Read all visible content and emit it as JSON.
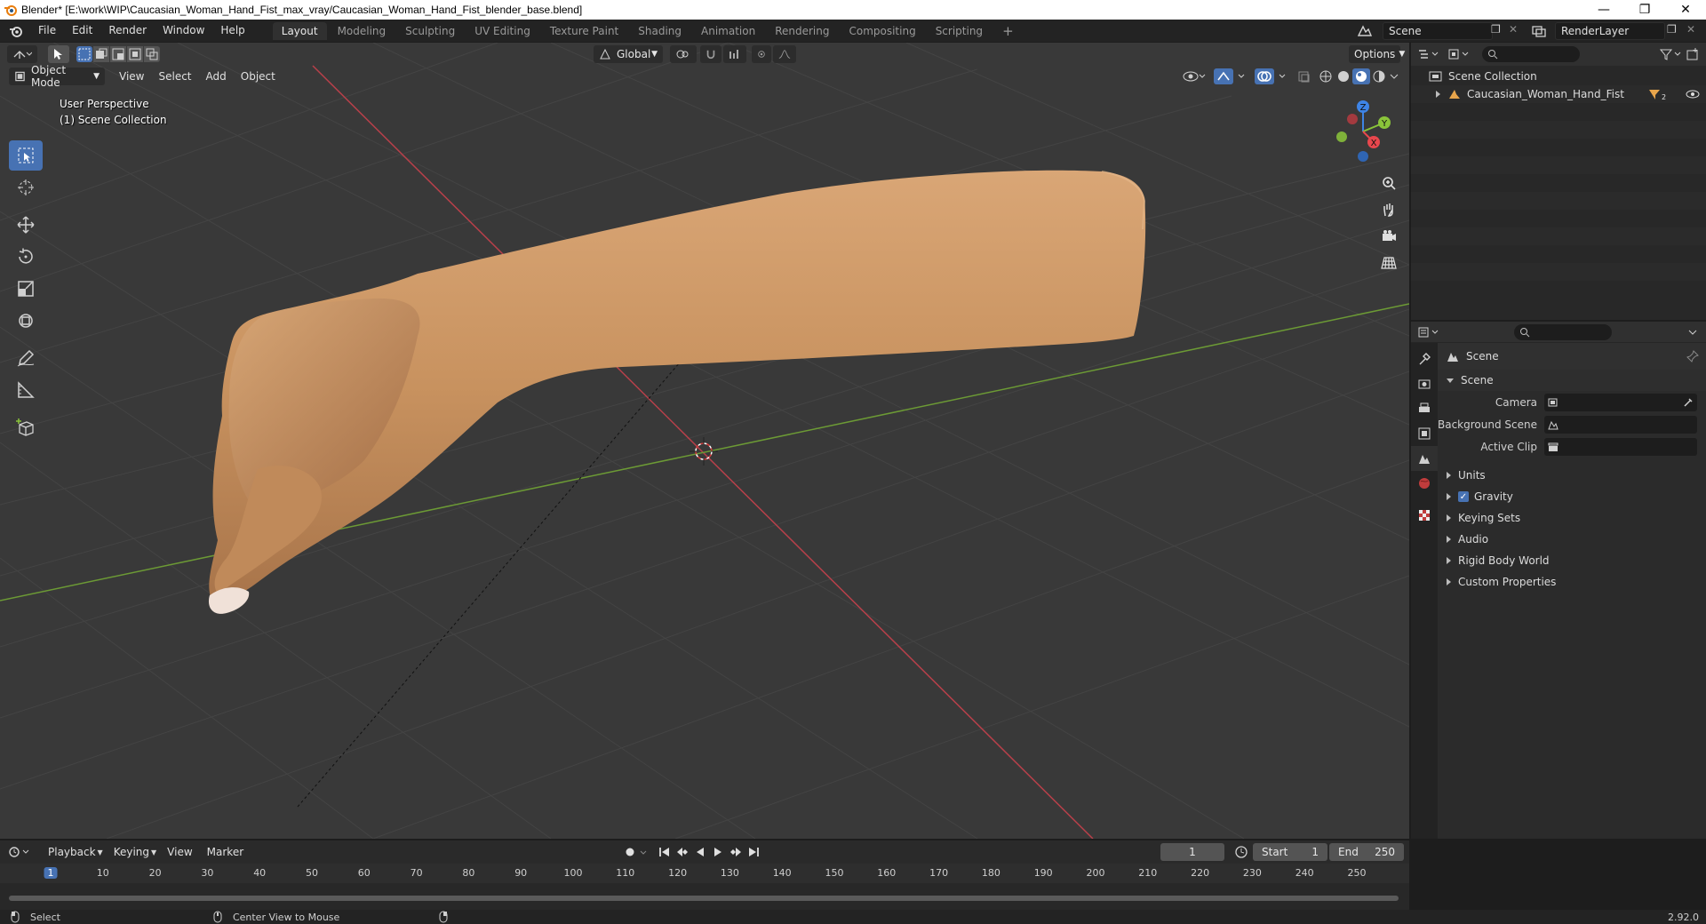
{
  "window": {
    "title": "Blender* [E:\\work\\WIP\\Caucasian_Woman_Hand_Fist_max_vray/Caucasian_Woman_Hand_Fist_blender_base.blend]"
  },
  "topbar": {
    "menus": [
      "File",
      "Edit",
      "Render",
      "Window",
      "Help"
    ],
    "workspaces": [
      "Layout",
      "Modeling",
      "Sculpting",
      "UV Editing",
      "Texture Paint",
      "Shading",
      "Animation",
      "Rendering",
      "Compositing",
      "Scripting"
    ],
    "active_workspace": "Layout",
    "scene": "Scene",
    "view_layer": "RenderLayer"
  },
  "viewport": {
    "transform_orientation": "Global",
    "options_label": "Options",
    "mode": "Object Mode",
    "menus": [
      "View",
      "Select",
      "Add",
      "Object"
    ],
    "overlay_line1": "User Perspective",
    "overlay_line2": "(1) Scene Collection",
    "gizmo_axes": {
      "x": "X",
      "y": "Y",
      "z": "Z"
    }
  },
  "outliner": {
    "root": "Scene Collection",
    "items": [
      {
        "label": "Caucasian_Woman_Hand_Fist",
        "badge": "2"
      }
    ]
  },
  "properties": {
    "context": "Scene",
    "panel_title": "Scene",
    "fields": [
      {
        "label": "Camera"
      },
      {
        "label": "Background Scene"
      },
      {
        "label": "Active Clip"
      }
    ],
    "subpanels": [
      "Units",
      "Gravity",
      "Keying Sets",
      "Audio",
      "Rigid Body World",
      "Custom Properties"
    ]
  },
  "timeline": {
    "menus": [
      "Playback",
      "Keying",
      "View",
      "Marker"
    ],
    "current_frame": "1",
    "start_label": "Start",
    "start": "1",
    "end_label": "End",
    "end": "250",
    "ticks": [
      "1",
      "10",
      "20",
      "30",
      "40",
      "50",
      "60",
      "70",
      "80",
      "90",
      "100",
      "110",
      "120",
      "130",
      "140",
      "150",
      "160",
      "170",
      "180",
      "190",
      "200",
      "210",
      "220",
      "230",
      "240",
      "250"
    ]
  },
  "statusbar": {
    "left": "Select",
    "middle": "Center View to Mouse",
    "version": "2.92.0"
  },
  "colors": {
    "accent": "#4772b3",
    "x_axis": "#e8474d",
    "y_axis": "#8ac43a",
    "z_axis": "#3e84e6",
    "skin": "#c8925f"
  }
}
